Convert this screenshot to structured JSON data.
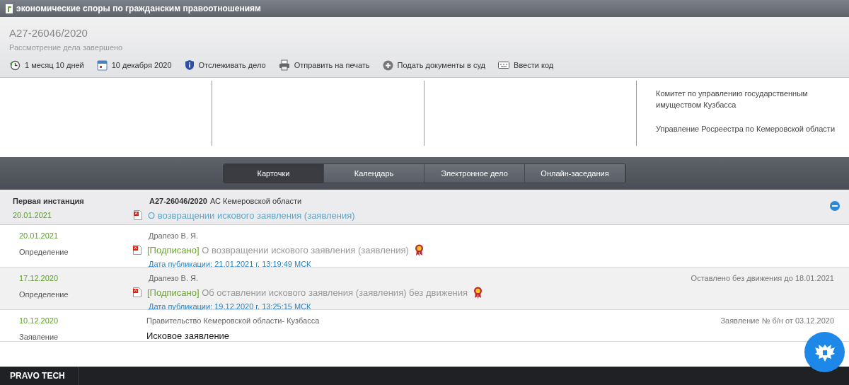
{
  "window": {
    "title": "экономические споры по гражданским правоотношениям"
  },
  "case": {
    "number": "А27-26046/2020",
    "status": "Рассмотрение дела завершено"
  },
  "toolbar": [
    {
      "kind": "duration",
      "label": "1 месяц 10 дней"
    },
    {
      "kind": "calendar",
      "label": "10 декабря 2020"
    },
    {
      "kind": "track",
      "label": "Отслеживать дело"
    },
    {
      "kind": "print",
      "label": "Отправить на печать"
    },
    {
      "kind": "submit",
      "label": "Подать документы в суд"
    },
    {
      "kind": "code",
      "label": "Ввести код"
    }
  ],
  "participants": {
    "column_4": [
      "Комитет по управлению государственным имуществом Кузбасса",
      "Управление Росреестра по Кемеровской области"
    ]
  },
  "tabs": [
    {
      "label": "Карточки",
      "selected": true
    },
    {
      "label": "Календарь",
      "selected": false
    },
    {
      "label": "Электронное дело",
      "selected": false
    },
    {
      "label": "Онлайн-заседания",
      "selected": false
    }
  ],
  "instance": {
    "name": "Первая инстанция",
    "date": "20.01.2021",
    "case_number": "А27-26046/2020",
    "court": "АС Кемеровской области",
    "title": "О возвращении искового заявления (заявления)",
    "expanded": true
  },
  "events": [
    {
      "kind": "document",
      "highlighted": false,
      "date": "20.01.2021",
      "type": "Определение",
      "author": "Драпезо В. Я.",
      "status": "[Подписано]",
      "title": "О возвращении искового заявления (заявления)",
      "published": "Дата публикации: 21.01.2021 г. 13:19:49 МСК"
    },
    {
      "kind": "document",
      "highlighted": true,
      "date": "17.12.2020",
      "type": "Определение",
      "author": "Драпезо В. Я.",
      "status": "[Подписано]",
      "title": "Об оставлении искового заявления (заявления) без движения",
      "published": "Дата публикации: 19.12.2020 г. 13:25:15 МСК",
      "note": "Оставлено без движения до 18.01.2021"
    },
    {
      "kind": "filing",
      "highlighted": false,
      "date": "10.12.2020",
      "type": "Заявление",
      "author": "Правительство Кемеровской области- Кузбасса",
      "title": "Исковое заявление",
      "note": "Заявление № б/н от 03.12.2020"
    }
  ],
  "footer": {
    "brand": "PRAVO TECH"
  }
}
